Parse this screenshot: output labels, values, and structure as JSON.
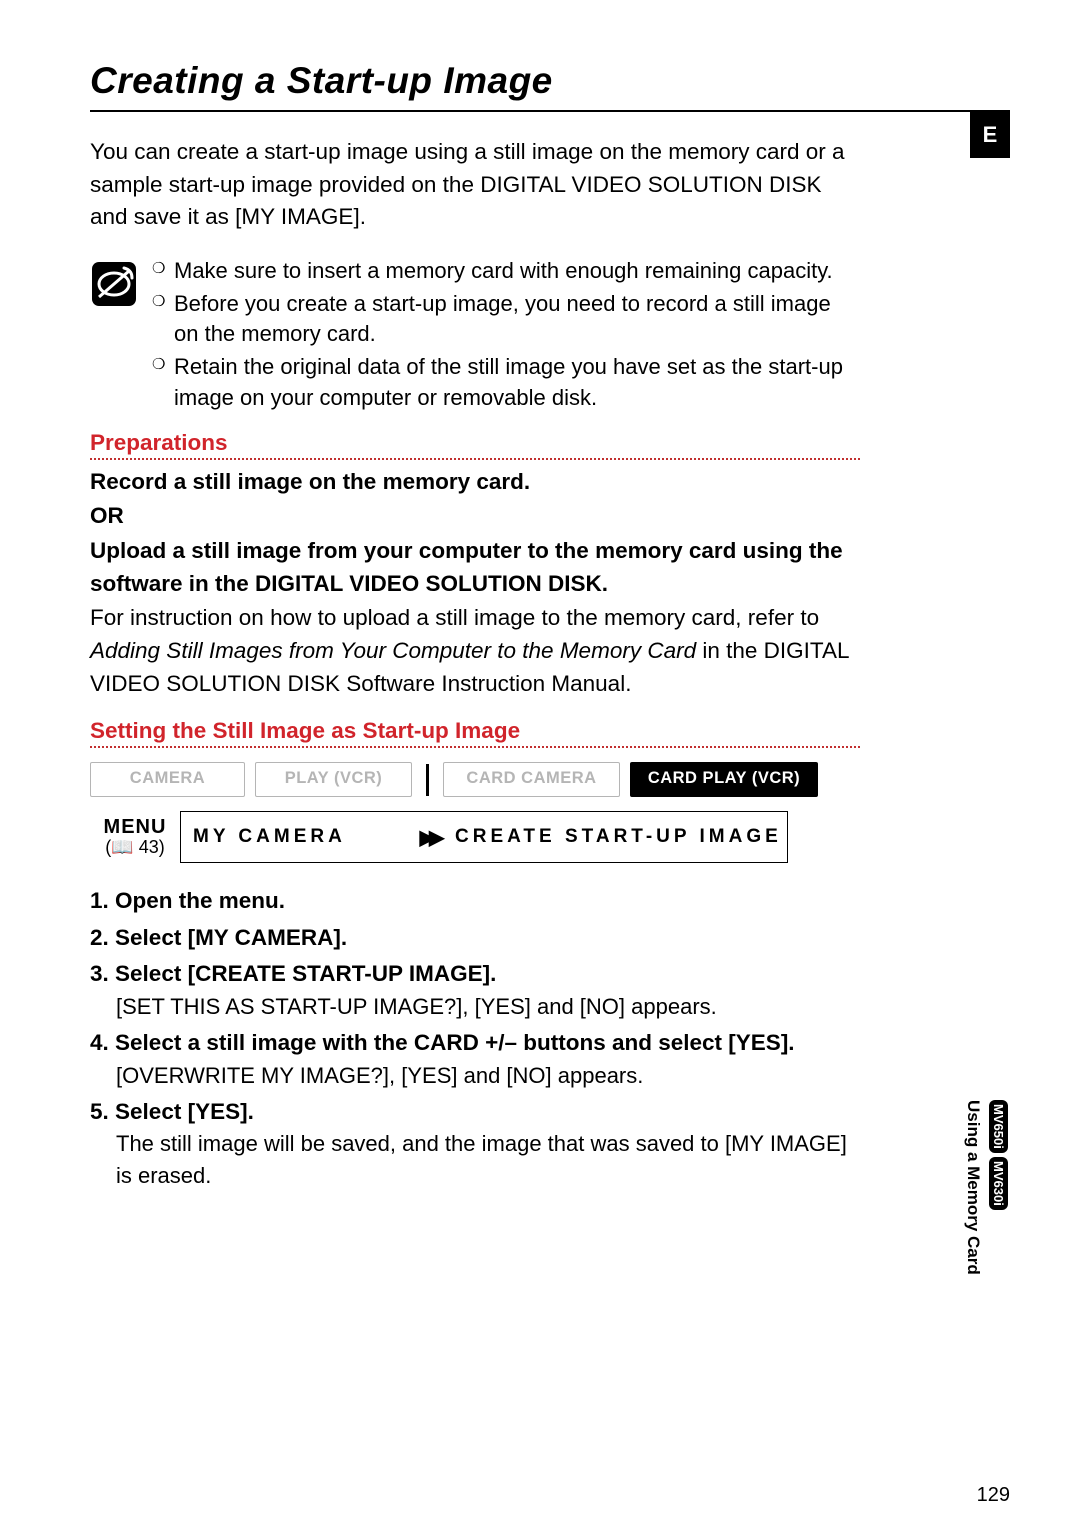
{
  "title": "Creating a Start-up Image",
  "intro": "You can create a start-up image using a still image on the memory card or a sample start-up image provided on the DIGITAL VIDEO SOLUTION DISK and save it as [MY IMAGE].",
  "notes": [
    "Make sure to insert a memory card with enough remaining capacity.",
    "Before you create a start-up image, you need to record a still image on the memory card.",
    "Retain the original data of the still image you have set as the start-up image on your computer or removable disk."
  ],
  "preparations": {
    "heading": "Preparations",
    "line1": "Record a still image on the memory card.",
    "or": "OR",
    "line2": "Upload a still image from your computer to the memory card using the software in the DIGITAL VIDEO SOLUTION DISK.",
    "instr_pre": "For instruction on how to upload a still image to the memory card, refer to ",
    "instr_italic": "Adding Still Images from Your Computer to the Memory Card",
    "instr_post": " in the DIGITAL VIDEO SOLUTION DISK Software Instruction Manual."
  },
  "setting": {
    "heading": "Setting the Still Image as Start-up Image"
  },
  "modes": {
    "m1": "CAMERA",
    "m2": "PLAY (VCR)",
    "m3": "CARD CAMERA",
    "m4": "CARD PLAY (VCR)"
  },
  "menu": {
    "label": "MENU",
    "ref": "43",
    "cell1": "MY CAMERA",
    "cell2": "CREATE START-UP IMAGE"
  },
  "steps": [
    {
      "head": "Open the menu."
    },
    {
      "head": "Select [MY CAMERA]."
    },
    {
      "head": "Select [CREATE START-UP IMAGE].",
      "sub": "[SET THIS AS START-UP IMAGE?], [YES] and [NO] appears."
    },
    {
      "head": "Select a still image with the CARD +/– buttons and select [YES].",
      "sub": "[OVERWRITE MY IMAGE?], [YES] and [NO] appears."
    },
    {
      "head": "Select [YES].",
      "sub": "The still image will be saved, and the image that was saved to [MY IMAGE] is erased."
    }
  ],
  "side": {
    "e": "E",
    "section": "Using a Memory Card",
    "models": [
      "MV650i",
      "MV630i"
    ]
  },
  "page_number": "129"
}
